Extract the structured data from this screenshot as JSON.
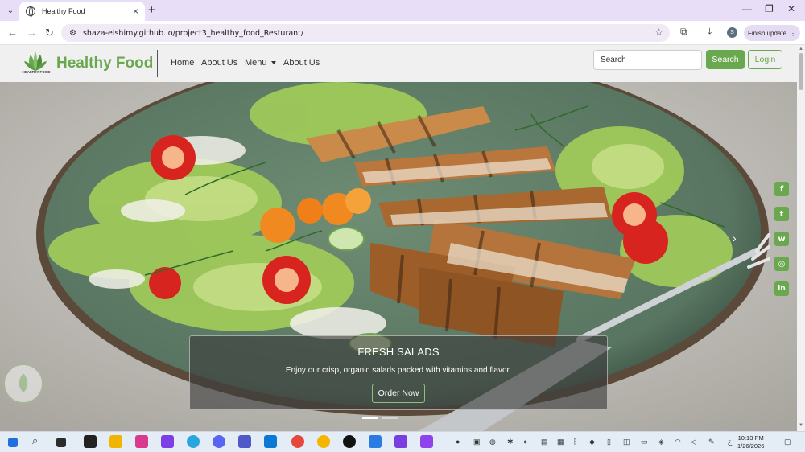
{
  "browser": {
    "tab_title": "Healthy Food",
    "url": "shaza-elshimy.github.io/project3_healthy_food_Resturant/",
    "profile_initial": "S",
    "finish_update": "Finish update",
    "icons": [
      "tab-search-icon",
      "back-icon",
      "forward-icon",
      "reload-icon",
      "site-info-icon",
      "bookmark-star-icon",
      "extensions-icon",
      "downloads-icon",
      "menu-icon",
      "minimize-icon",
      "maximize-icon",
      "close-icon"
    ]
  },
  "site": {
    "brand": "Healthy Food",
    "logo_subtext": "HEALTHY FOOD",
    "nav": {
      "home": "Home",
      "about1": "About Us",
      "menu": "Menu",
      "about2": "About Us"
    },
    "search": {
      "placeholder": "Search",
      "button": "Search"
    },
    "login": "Login",
    "accent_color": "#6aa84f"
  },
  "hero": {
    "caption_title": "FRESH SALADS",
    "caption_text": "Enjoy our crisp, organic salads packed with vitamins and flavor.",
    "button": "Order Now",
    "slides_active": 1,
    "slides_total": 2
  },
  "social": [
    {
      "name": "facebook",
      "glyph": "f"
    },
    {
      "name": "twitter",
      "glyph": "t"
    },
    {
      "name": "whatsapp",
      "glyph": "w"
    },
    {
      "name": "instagram",
      "glyph": "◎"
    },
    {
      "name": "linkedin",
      "glyph": "in"
    }
  ],
  "taskbar": {
    "time": "10:13 PM",
    "date": "1/26/2026",
    "lang": "ع"
  }
}
